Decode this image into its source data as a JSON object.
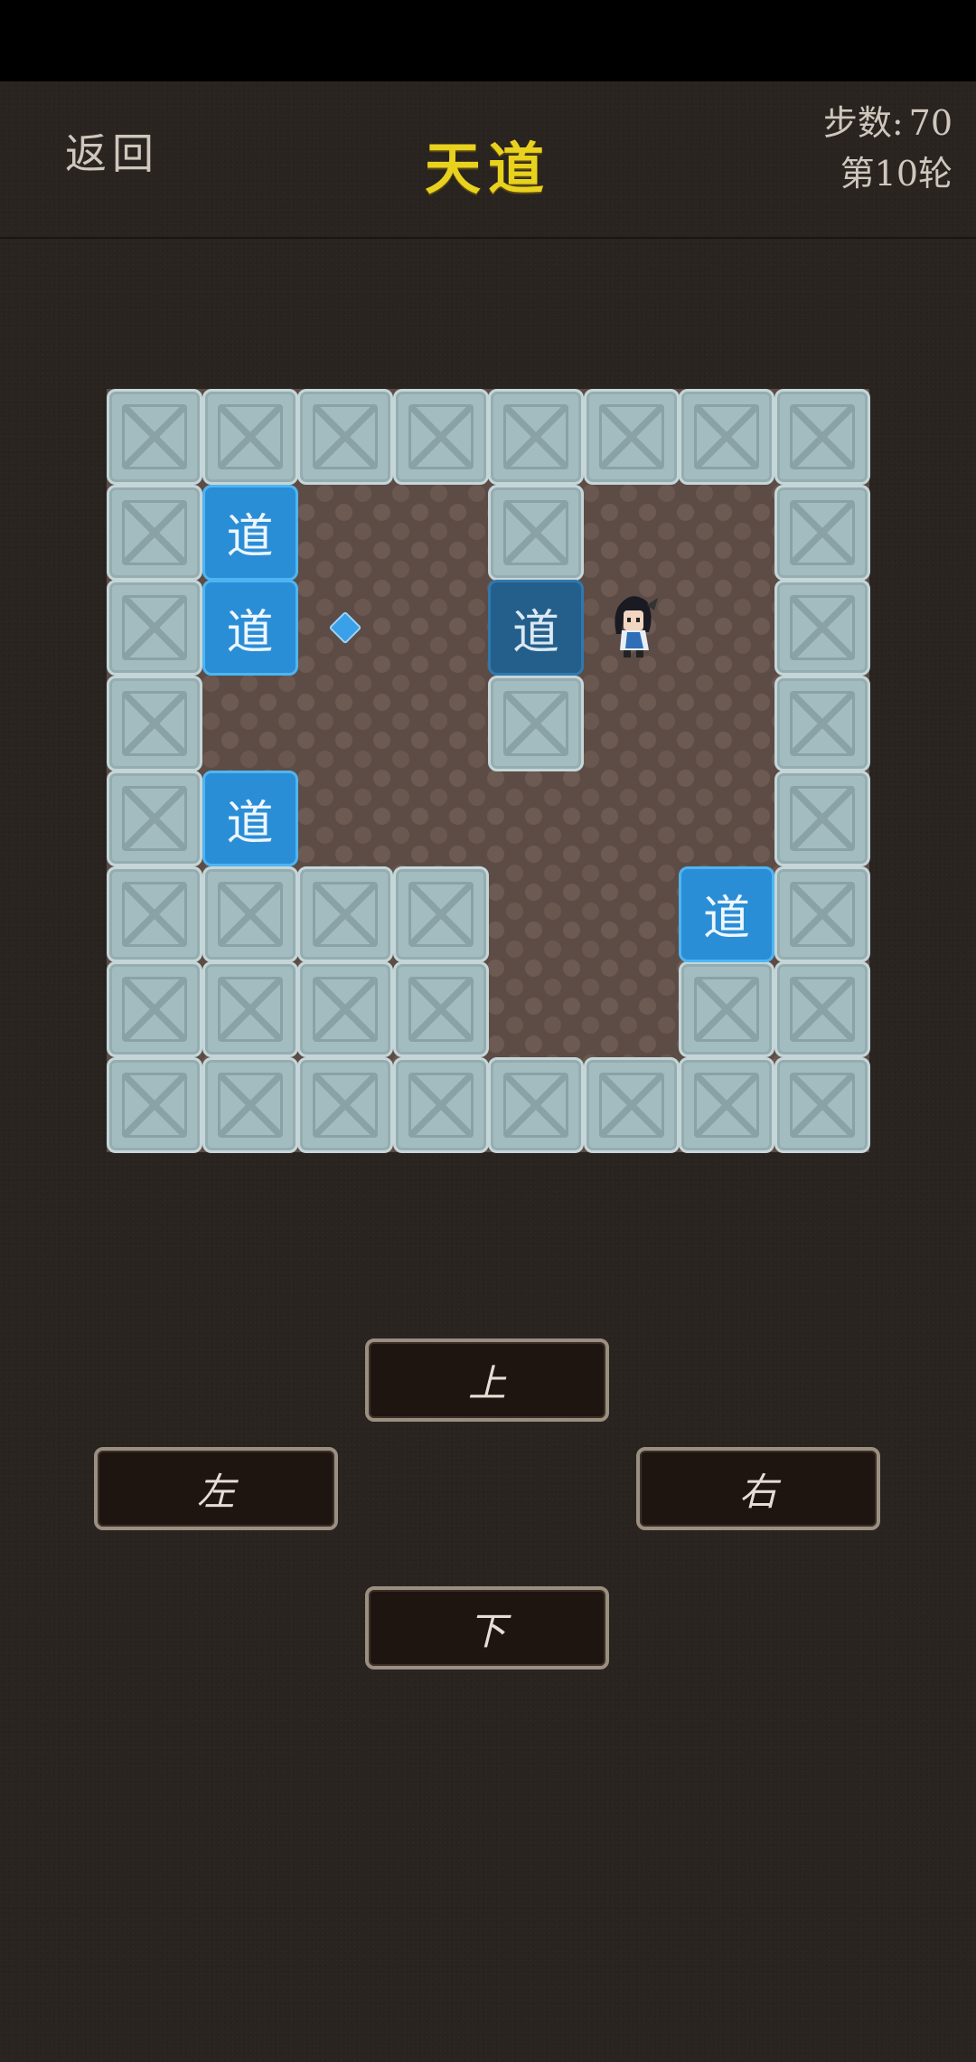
{
  "header": {
    "back_label": "返回",
    "title": "天道",
    "steps_label": "步数:",
    "steps_value": "70",
    "round_label": "第10轮"
  },
  "board": {
    "cols": 8,
    "rows": 8,
    "walls": [
      [
        0,
        0
      ],
      [
        1,
        0
      ],
      [
        2,
        0
      ],
      [
        3,
        0
      ],
      [
        4,
        0
      ],
      [
        5,
        0
      ],
      [
        6,
        0
      ],
      [
        7,
        0
      ],
      [
        0,
        1
      ],
      [
        4,
        1
      ],
      [
        7,
        1
      ],
      [
        0,
        2
      ],
      [
        7,
        2
      ],
      [
        0,
        3
      ],
      [
        4,
        3
      ],
      [
        7,
        3
      ],
      [
        0,
        4
      ],
      [
        7,
        4
      ],
      [
        0,
        5
      ],
      [
        1,
        5
      ],
      [
        2,
        5
      ],
      [
        3,
        5
      ],
      [
        7,
        5
      ],
      [
        0,
        6
      ],
      [
        1,
        6
      ],
      [
        2,
        6
      ],
      [
        3,
        6
      ],
      [
        6,
        6
      ],
      [
        7,
        6
      ],
      [
        0,
        7
      ],
      [
        1,
        7
      ],
      [
        2,
        7
      ],
      [
        3,
        7
      ],
      [
        4,
        7
      ],
      [
        5,
        7
      ],
      [
        6,
        7
      ],
      [
        7,
        7
      ]
    ],
    "boxes": [
      {
        "col": 1,
        "row": 1,
        "label": "道",
        "on_target": false
      },
      {
        "col": 1,
        "row": 2,
        "label": "道",
        "on_target": false
      },
      {
        "col": 4,
        "row": 2,
        "label": "道",
        "on_target": true
      },
      {
        "col": 1,
        "row": 4,
        "label": "道",
        "on_target": false
      },
      {
        "col": 6,
        "row": 5,
        "label": "道",
        "on_target": false
      }
    ],
    "targets": [
      [
        2,
        2
      ]
    ],
    "player": [
      5,
      2
    ]
  },
  "controls": {
    "up": "上",
    "left": "左",
    "right": "右",
    "down": "下"
  },
  "colors": {
    "title": "#e8d21e",
    "box": "#2a8ed6",
    "wall": "#a3bcbf",
    "floor": "#5c4c45"
  }
}
